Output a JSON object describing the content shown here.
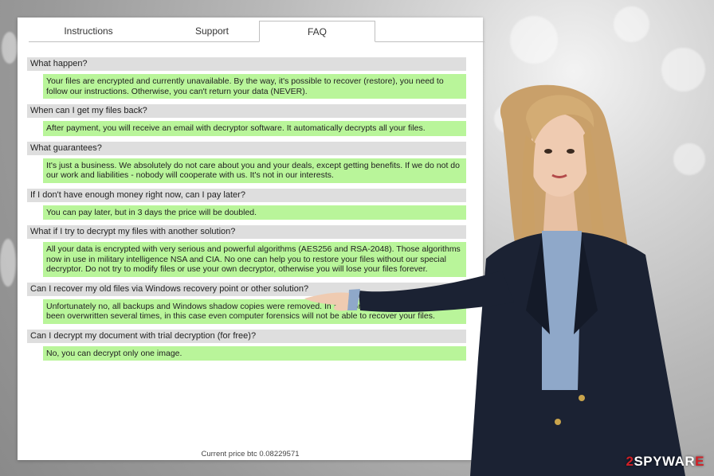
{
  "tabs": [
    {
      "label": "Instructions"
    },
    {
      "label": "Support"
    },
    {
      "label": "FAQ",
      "active": true
    }
  ],
  "faq": [
    {
      "q": "What happen?",
      "a": "Your files are encrypted and currently unavailable. By the way, it's possible to recover (restore), you need to follow our instructions. Otherwise, you can't return your data (NEVER)."
    },
    {
      "q": "When can I get my files back?",
      "a": "After payment, you will receive an email with decryptor software. It automatically decrypts all your files."
    },
    {
      "q": "What guarantees?",
      "a": "It's just a business. We absolutely do not care about you and your deals, except getting benefits. If we do not do our work and liabilities - nobody will cooperate with us. It's not in our interests."
    },
    {
      "q": "If I don't have enough money right now, can I pay later?",
      "a": "You can pay later, but in 3 days the price will be doubled."
    },
    {
      "q": "What if I try to decrypt my files with another solution?",
      "a": "All your data is encrypted with very serious and powerful algorithms (AES256 and RSA-2048). Those algorithms now in use in military intelligence NSA and CIA. No one can help you to restore your files without our special decryptor. Do not try to modify files or use your own decryptor, otherwise you will lose your files forever."
    },
    {
      "q": "Can I recover my old files via Windows recovery point or other solution?",
      "a": "Unfortunately no, all backups and Windows shadow copies were removed. In addition, hard disk sectors have been overwritten several times, in this case even computer forensics will not be able to recover your files."
    },
    {
      "q": "Can I decrypt my document with trial decryption (for free)?",
      "a": "No, you can decrypt only one image."
    }
  ],
  "footer": {
    "price": "Current price btc 0.08229571"
  },
  "watermark": {
    "prefix": "2",
    "rest": "SPYWAR",
    "suffix": "E"
  },
  "colors": {
    "question_bg": "#dedede",
    "answer_bg": "#b9f59a"
  }
}
